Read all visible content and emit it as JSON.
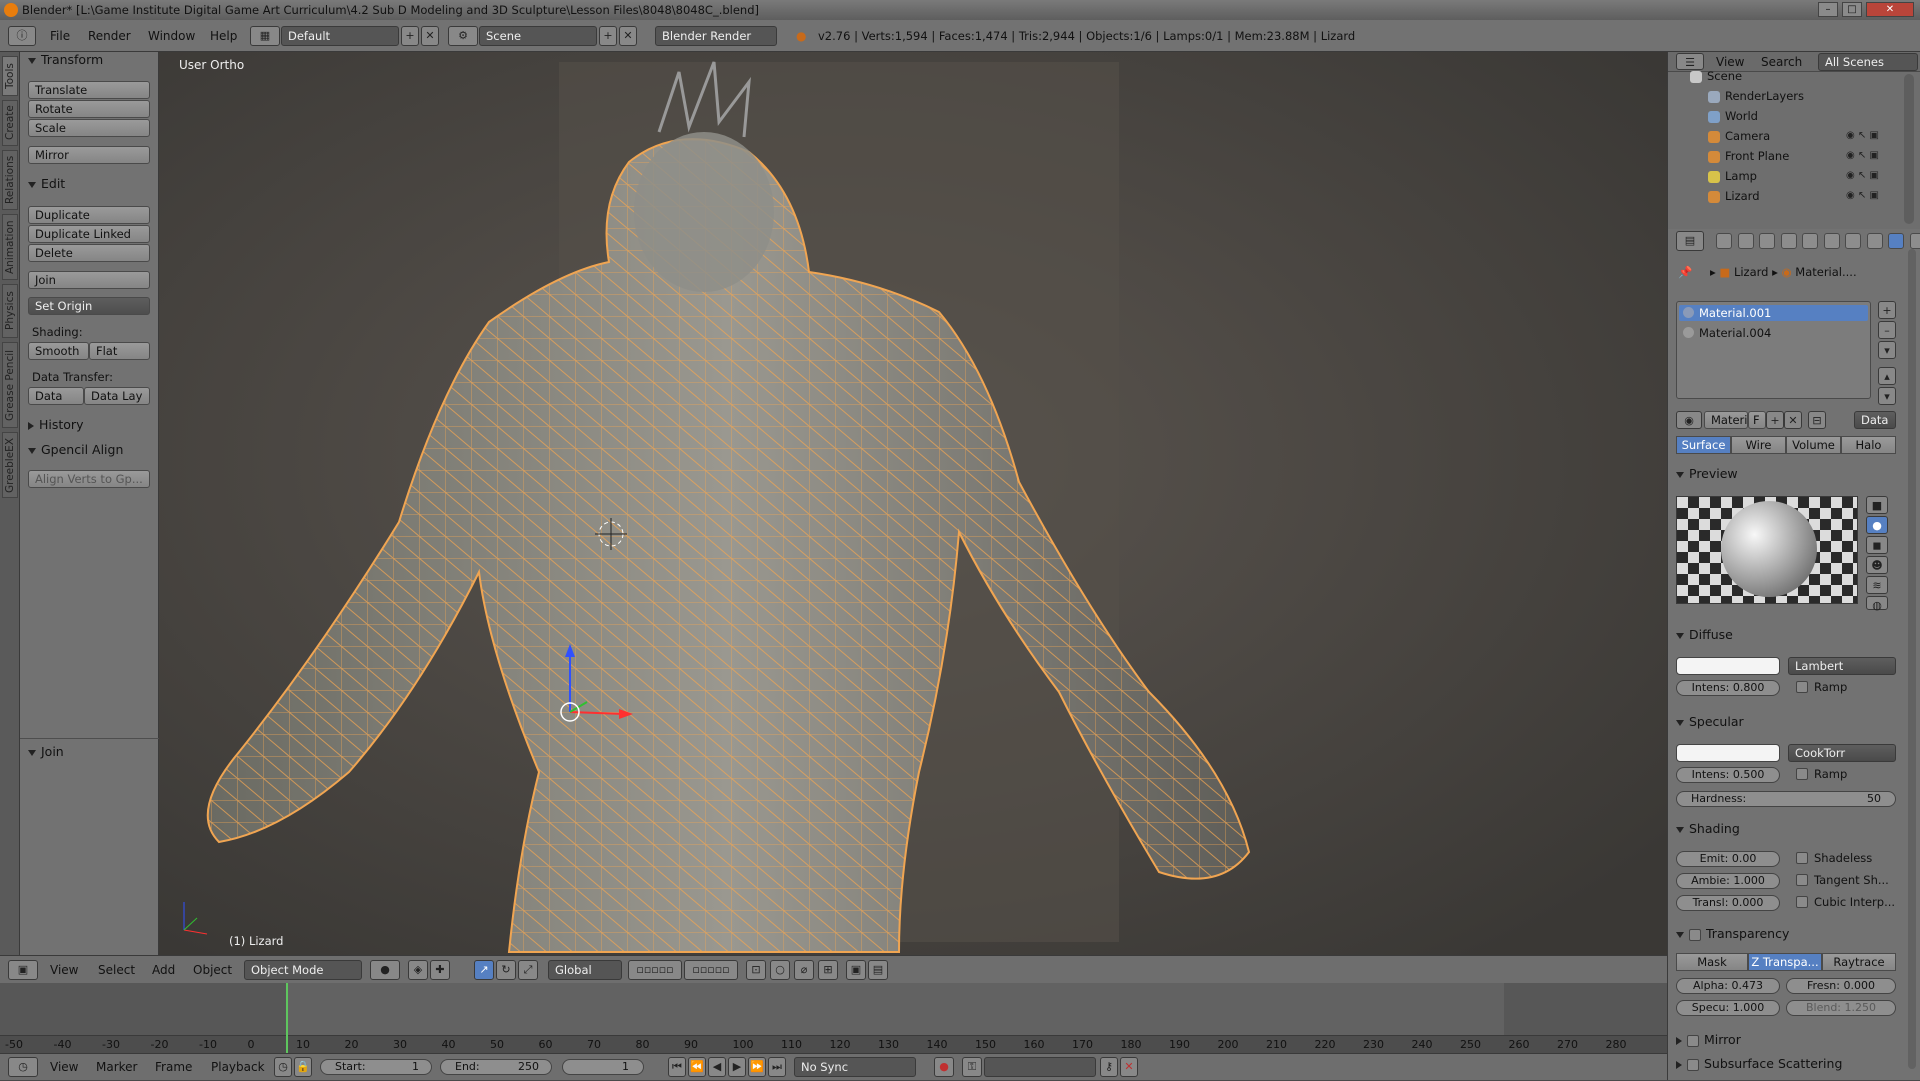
{
  "window": {
    "title": "Blender* [L:\\Game Institute Digital Game Art  Curriculum\\4.2 Sub D Modeling and 3D Sculpture\\Lesson Files\\8048\\8048C_.blend]"
  },
  "topbar": {
    "menus": [
      "File",
      "Render",
      "Window",
      "Help"
    ],
    "layout": "Default",
    "scene": "Scene",
    "engine": "Blender Render",
    "stats": "v2.76 | Verts:1,594 | Faces:1,474 | Tris:2,944 | Objects:1/6 | Lamps:0/1 | Mem:23.88M | Lizard"
  },
  "left_tabs": [
    "Tools",
    "Create",
    "Relations",
    "Animation",
    "Physics",
    "Grease Pencil",
    "GreebleEX"
  ],
  "toolshelf": {
    "transform_title": "Transform",
    "translate": "Translate",
    "rotate": "Rotate",
    "scale": "Scale",
    "mirror": "Mirror",
    "edit_title": "Edit",
    "duplicate": "Duplicate",
    "duplicate_linked": "Duplicate Linked",
    "delete": "Delete",
    "join": "Join",
    "set_origin": "Set Origin",
    "shading_label": "Shading:",
    "smooth": "Smooth",
    "flat": "Flat",
    "data_transfer_label": "Data Transfer:",
    "data": "Data",
    "data_lay": "Data Lay",
    "history_title": "History",
    "gpencil_title": "Gpencil Align",
    "align_verts": "Align Verts to Gp...",
    "operator_title": "Join"
  },
  "viewport": {
    "view_label": "User Ortho",
    "object_label": "(1) Lizard"
  },
  "viewport_header": {
    "menus": [
      "View",
      "Select",
      "Add",
      "Object"
    ],
    "mode": "Object Mode",
    "orientation": "Global"
  },
  "timeline": {
    "ticks": [
      "-50",
      "-40",
      "-30",
      "-20",
      "-10",
      "0",
      "10",
      "20",
      "30",
      "40",
      "50",
      "60",
      "70",
      "80",
      "90",
      "100",
      "110",
      "120",
      "130",
      "140",
      "150",
      "160",
      "170",
      "180",
      "190",
      "200",
      "210",
      "220",
      "230",
      "240",
      "250",
      "260",
      "270",
      "280"
    ],
    "menus": [
      "View",
      "Marker",
      "Frame",
      "Playback"
    ],
    "start_label": "Start:",
    "start": "1",
    "end_label": "End:",
    "end": "250",
    "current": "1",
    "sync": "No Sync"
  },
  "outliner": {
    "menus": [
      "View",
      "Search"
    ],
    "scope": "All Scenes",
    "items": [
      {
        "label": "Scene",
        "icon_color": "#c8c8c8"
      },
      {
        "label": "RenderLayers",
        "icon_color": "#9aa9bd"
      },
      {
        "label": "World",
        "icon_color": "#7fa0c8"
      },
      {
        "label": "Camera",
        "icon_color": "#d48a3a"
      },
      {
        "label": "Front Plane",
        "icon_color": "#d48a3a"
      },
      {
        "label": "Lamp",
        "icon_color": "#d8c34a"
      },
      {
        "label": "Lizard",
        "icon_color": "#d48a3a"
      }
    ]
  },
  "properties": {
    "breadcrumb_object": "Lizard",
    "breadcrumb_material": "Material....",
    "slots": [
      "Material.001",
      "Material.004"
    ],
    "material_field": "Materi",
    "fake_user": "F",
    "data_link": "Data",
    "tabs": [
      "Surface",
      "Wire",
      "Volume",
      "Halo"
    ],
    "preview_title": "Preview",
    "diffuse_title": "Diffuse",
    "diffuse_shader": "Lambert",
    "diffuse_intensity": "Intens: 0.800",
    "ramp": "Ramp",
    "specular_title": "Specular",
    "specular_shader": "CookTorr",
    "specular_intensity": "Intens: 0.500",
    "hardness_label": "Hardness:",
    "hardness": "50",
    "shading_title": "Shading",
    "emit": "Emit:   0.00",
    "ambient": "Ambie: 1.000",
    "translucency": "Transl: 0.000",
    "shadeless": "Shadeless",
    "tangent": "Tangent Sh...",
    "cubic": "Cubic Interp...",
    "transparency_title": "Transparency",
    "trans_modes": [
      "Mask",
      "Z Transpa...",
      "Raytrace"
    ],
    "alpha": "Alpha: 0.473",
    "fresnel": "Fresn: 0.000",
    "specular_alpha": "Specu: 1.000",
    "blend": "Blend: 1.250",
    "mirror_title": "Mirror",
    "sss_title": "Subsurface Scattering"
  },
  "colors": {
    "accent": "#5680c2",
    "wire": "#f0a552"
  }
}
